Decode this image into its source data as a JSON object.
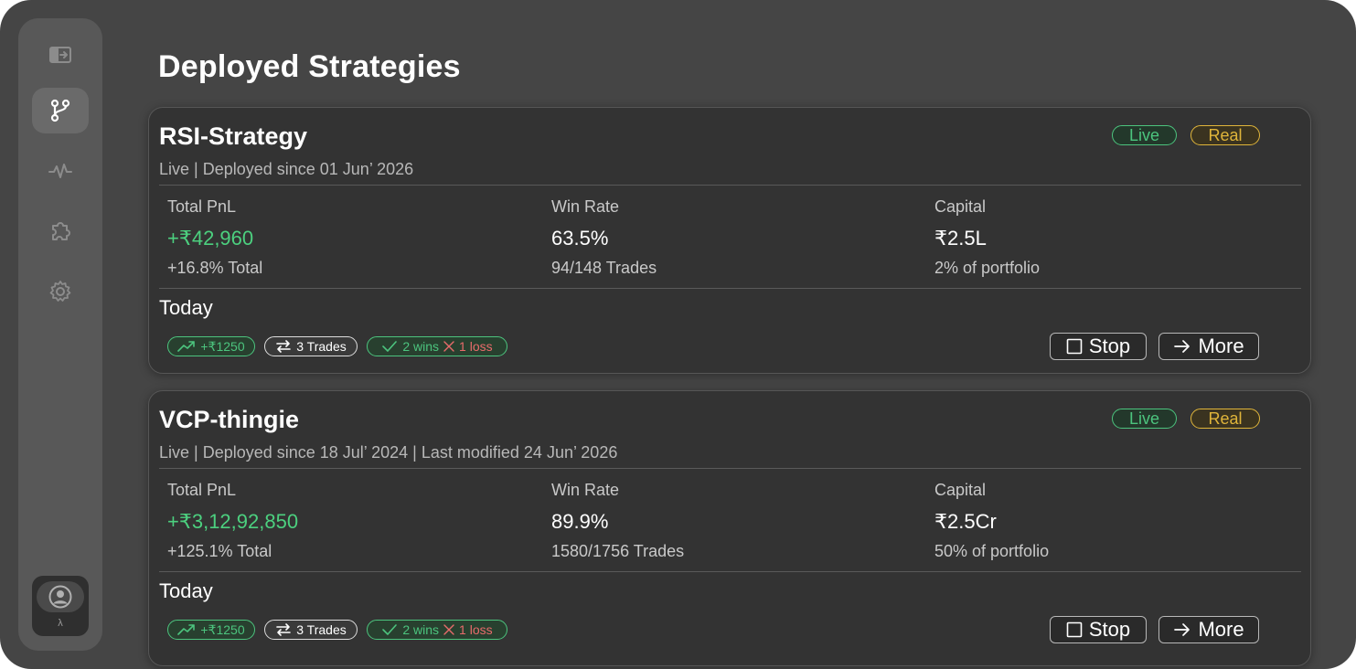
{
  "sidebar": {
    "items": [
      {
        "icon": "panel-expand-icon"
      },
      {
        "icon": "git-branch-icon",
        "active": true
      },
      {
        "icon": "activity-icon"
      },
      {
        "icon": "puzzle-icon"
      },
      {
        "icon": "gear-icon"
      }
    ],
    "profile": {
      "icon": "user-avatar-icon",
      "label": "λ"
    }
  },
  "page": {
    "title": "Deployed Strategies"
  },
  "colors": {
    "positive": "#4cd07f",
    "live": "#4cc47e",
    "real": "#e0b53a",
    "loss": "#e86b6b"
  },
  "strategies": [
    {
      "name": "RSI-Strategy",
      "subtitle": "Live | Deployed since 01 Jun’ 2026",
      "tags": {
        "live": "Live",
        "real": "Real"
      },
      "pnl": {
        "label": "Total PnL",
        "value": "+₹42,960",
        "sub": "+16.8% Total"
      },
      "winrate": {
        "label": "Win Rate",
        "value": "63.5%",
        "sub": "94/148 Trades"
      },
      "capital": {
        "label": "Capital",
        "value": "₹2.5L",
        "sub": "2% of portfolio"
      },
      "today": {
        "label": "Today",
        "pnl": "+₹1250",
        "trades": "3 Trades",
        "wins": "2 wins",
        "losses": "1 loss"
      },
      "actions": {
        "stop": "Stop",
        "more": "More"
      }
    },
    {
      "name": "VCP-thingie",
      "subtitle": "Live | Deployed since 18 Jul’ 2024 | Last modified 24 Jun’ 2026",
      "tags": {
        "live": "Live",
        "real": "Real"
      },
      "pnl": {
        "label": "Total PnL",
        "value": "+₹3,12,92,850",
        "sub": "+125.1% Total"
      },
      "winrate": {
        "label": "Win Rate",
        "value": "89.9%",
        "sub": "1580/1756 Trades"
      },
      "capital": {
        "label": "Capital",
        "value": "₹2.5Cr",
        "sub": "50% of portfolio"
      },
      "today": {
        "label": "Today",
        "pnl": "+₹1250",
        "trades": "3 Trades",
        "wins": "2 wins",
        "losses": "1 loss"
      },
      "actions": {
        "stop": "Stop",
        "more": "More"
      }
    }
  ]
}
